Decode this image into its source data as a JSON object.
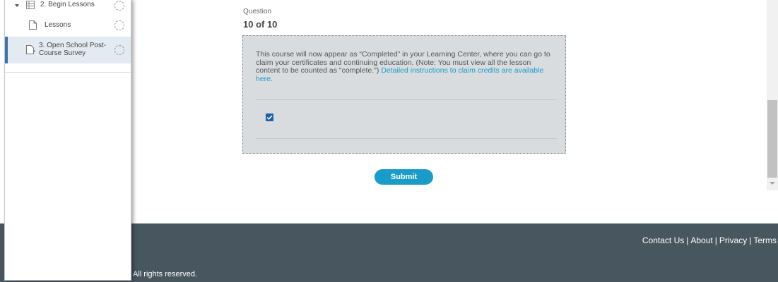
{
  "sidebar": {
    "items": [
      {
        "label": "2. Begin Lessons"
      },
      {
        "label": "Lessons"
      },
      {
        "label_line1": "3. Open School Post-",
        "label_line2": "Course Survey"
      }
    ]
  },
  "question": {
    "label": "Question",
    "counter": "10 of 10",
    "text": "This course will now appear as “Completed” in your Learning Center, where you can go to claim your certificates and continuing education. (Note: You must view all the lesson content to be counted as \"complete.\") ",
    "link_text": "Detailed instructions to claim credits are available here.",
    "checked": true
  },
  "submit_label": "Submit",
  "footer": {
    "links": [
      "Contact Us",
      "About",
      "Privacy",
      "Terms"
    ],
    "separator": "|",
    "copyright": "All rights reserved."
  },
  "colors": {
    "accent": "#1a9cc9",
    "footer_bg": "#485660",
    "selected_bg": "#e3eaf1"
  }
}
